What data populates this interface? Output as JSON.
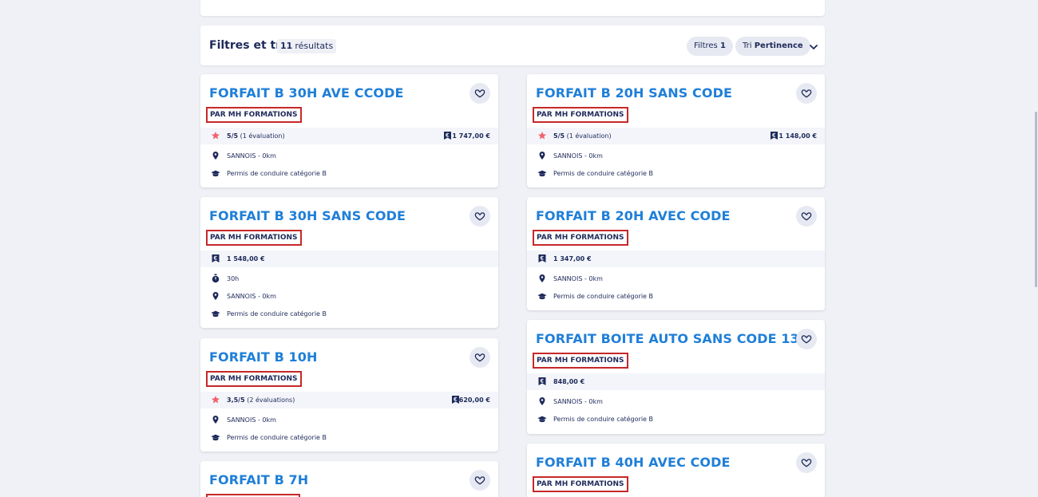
{
  "filter_bar": {
    "title": "Filtres et tri",
    "results_count": "11",
    "results_label": "résultats",
    "filters_label": "Filtres",
    "filters_count": "1",
    "sort_label": "Tri",
    "sort_value": "Pertinence"
  },
  "cards": [
    {
      "title": "FORFAIT B 30H AVE CCODE",
      "org": "PAR MH FORMATIONS",
      "rating": "5/5",
      "reviews": "(1 évaluation)",
      "price": "1 747,00 €",
      "location": "SANNOIS - 0km",
      "category": "Permis de conduire catégorie B"
    },
    {
      "title": "FORFAIT B 20H SANS CODE",
      "org": "PAR MH FORMATIONS",
      "rating": "5/5",
      "reviews": "(1 évaluation)",
      "price": "1 148,00 €",
      "location": "SANNOIS - 0km",
      "category": "Permis de conduire catégorie B"
    },
    {
      "title": "FORFAIT B 30H SANS CODE",
      "org": "PAR MH FORMATIONS",
      "price": "1 548,00 €",
      "duration": "30h",
      "location": "SANNOIS - 0km",
      "category": "Permis de conduire catégorie B"
    },
    {
      "title": "FORFAIT B 20H AVEC CODE",
      "org": "PAR MH FORMATIONS",
      "price": "1 347,00 €",
      "location": "SANNOIS - 0km",
      "category": "Permis de conduire catégorie B"
    },
    {
      "title": "FORFAIT B 10H",
      "org": "PAR MH FORMATIONS",
      "rating": "3,5/5",
      "reviews": "(2 évaluations)",
      "price": "620,00 €",
      "location": "SANNOIS - 0km",
      "category": "Permis de conduire catégorie B"
    },
    {
      "title": "FORFAIT BOITE AUTO SANS CODE 13H",
      "org": "PAR MH FORMATIONS",
      "price": "848,00 €",
      "location": "SANNOIS - 0km",
      "category": "Permis de conduire catégorie B"
    },
    {
      "title": "FORFAIT B 7H"
    },
    {
      "title": "FORFAIT B 40H AVEC CODE",
      "org": "PAR MH FORMATIONS"
    }
  ],
  "icons": {
    "favorite": "heart-outline-icon",
    "rating": "star-icon",
    "price": "price-tag-icon",
    "location": "map-pin-icon",
    "category": "graduation-cap-icon",
    "duration": "stopwatch-icon"
  },
  "colors": {
    "title": "#1f7fd8",
    "text": "#1e2a5a",
    "highlight_border": "#c62828",
    "star": "#f0626b",
    "background": "#f0f1f6"
  }
}
